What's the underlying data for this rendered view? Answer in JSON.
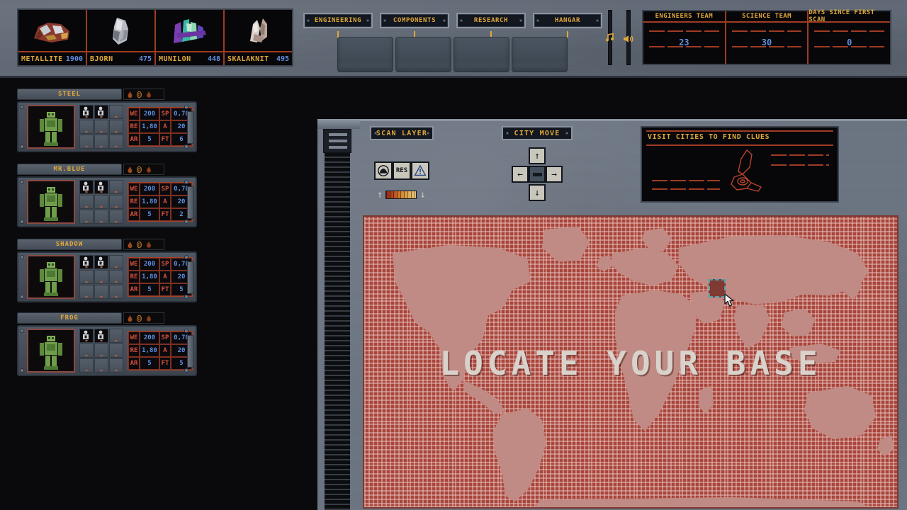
{
  "topbar": {
    "resources": [
      {
        "name": "METALLITE",
        "value": "1900",
        "icon": "metallite-ore-icon"
      },
      {
        "name": "BJORN",
        "value": "475",
        "icon": "bjorn-ore-icon"
      },
      {
        "name": "MUNILON",
        "value": "448",
        "icon": "munilon-ore-icon"
      },
      {
        "name": "SKALAKNIT",
        "value": "495",
        "icon": "skalaknit-ore-icon"
      }
    ],
    "tabs": [
      {
        "label": "ENGINEERING"
      },
      {
        "label": "COMPONENTS"
      },
      {
        "label": "RESEARCH"
      },
      {
        "label": "HANGAR"
      }
    ],
    "sliders": [
      {
        "name": "music-slider",
        "icon": "music-note-icon"
      },
      {
        "name": "volume-slider",
        "icon": "speaker-icon"
      }
    ],
    "stats": [
      {
        "label": "ENGINEERS TEAM",
        "value": "23"
      },
      {
        "label": "SCIENCE TEAM",
        "value": "30"
      },
      {
        "label": "DAYS SINCE FIRST SCAN",
        "value": "0"
      }
    ]
  },
  "mechs": [
    {
      "name": "STEEL",
      "stats": {
        "WE": "200",
        "SP": "0,70",
        "RE": "1,80",
        "A": "20",
        "AR": "5",
        "FT": "6"
      }
    },
    {
      "name": "MR.BLUE",
      "stats": {
        "WE": "200",
        "SP": "0,70",
        "RE": "1,80",
        "A": "20",
        "AR": "5",
        "FT": "2"
      }
    },
    {
      "name": "SHADOW",
      "stats": {
        "WE": "200",
        "SP": "0,70",
        "RE": "1,80",
        "A": "20",
        "AR": "5",
        "FT": "5"
      }
    },
    {
      "name": "FROG",
      "stats": {
        "WE": "200",
        "SP": "0,70",
        "RE": "1,80",
        "A": "20",
        "AR": "5",
        "FT": "5"
      }
    }
  ],
  "stat_keys": {
    "we": "WE",
    "sp": "SP",
    "re": "RE",
    "a": "A",
    "ar": "AR",
    "ft": "FT"
  },
  "controls": {
    "scan_layer_label": "SCAN LAYER",
    "city_move_label": "CITY MOVE",
    "scan_buttons": [
      {
        "name": "scan-radar-button",
        "label": ""
      },
      {
        "name": "scan-res-button",
        "label": "RES"
      },
      {
        "name": "scan-hazard-button",
        "label": ""
      }
    ],
    "layer_up_arrow": "↑",
    "layer_down_arrow": "↓",
    "dpad": {
      "up": "↑",
      "down": "↓",
      "left": "←",
      "right": "→"
    }
  },
  "clues": {
    "title": "VISIT CITIES TO FIND CLUES"
  },
  "map": {
    "title": "LOCATE YOUR BASE",
    "background_color": "#a8463c",
    "land_color": "#c08b84",
    "selection_color": "#54a0a8"
  }
}
